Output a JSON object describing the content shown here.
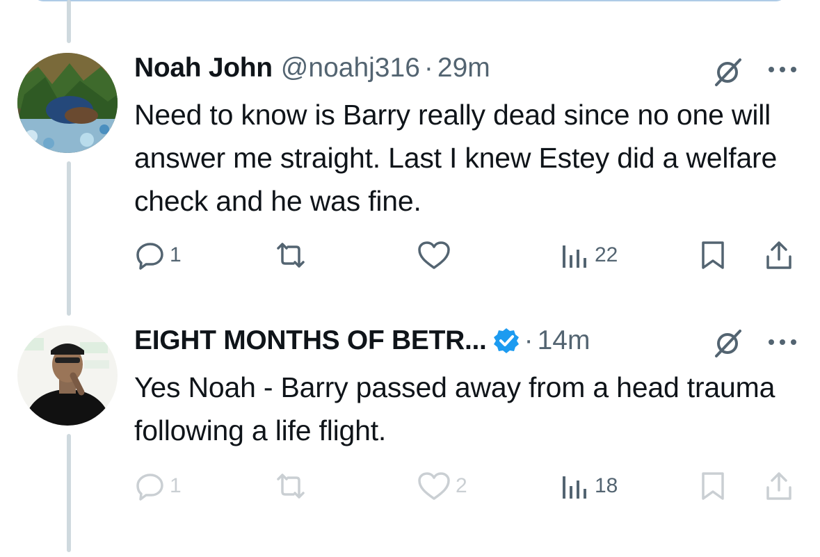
{
  "tweets": [
    {
      "name": "Noah John",
      "handle": "@noahj316",
      "dot": "·",
      "time": "29m",
      "text": "Need to know is Barry really dead since no one will answer me straight. Last I knew Estey did a welfare check and he was fine.",
      "replies": "1",
      "retweets": "",
      "likes": "",
      "views": "22",
      "verified": false
    },
    {
      "name": "EIGHT MONTHS OF BETR...",
      "handle": "",
      "dot": "·",
      "time": "14m",
      "text": "Yes Noah  - Barry passed away from a head trauma following a life flight.",
      "replies": "1",
      "retweets": "",
      "likes": "2",
      "views": "18",
      "verified": true
    }
  ],
  "colors": {
    "text": "#0f1419",
    "muted": "#536471",
    "thread_line": "#cfd9de",
    "verified_blue": "#1d9bf0"
  },
  "icons": [
    "reply-icon",
    "retweet-icon",
    "like-icon",
    "views-icon",
    "bookmark-icon",
    "share-icon",
    "grok-icon",
    "more-icon",
    "verified-badge-icon"
  ]
}
